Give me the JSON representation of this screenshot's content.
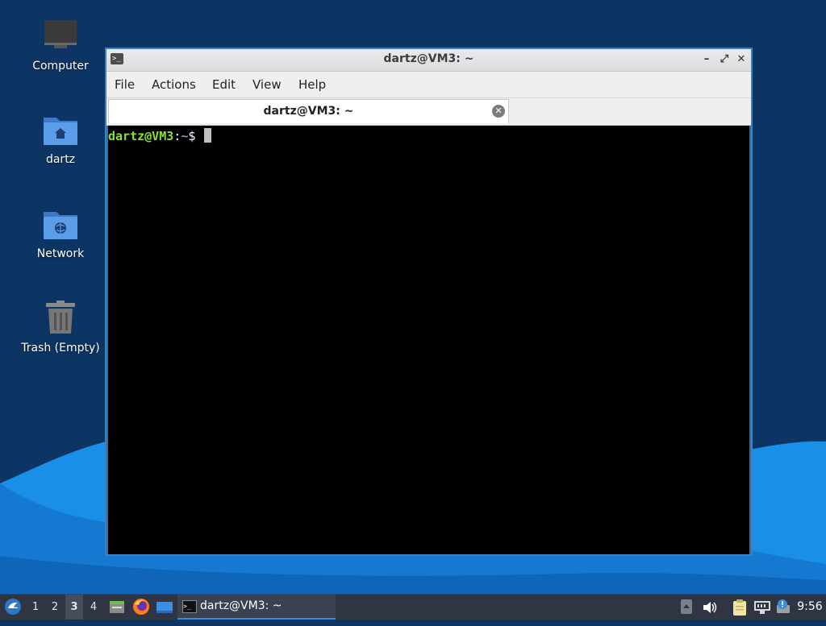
{
  "desktop": {
    "icons": [
      {
        "label": "Computer",
        "icon": "computer-icon"
      },
      {
        "label": "dartz",
        "icon": "home-folder-icon"
      },
      {
        "label": "Network",
        "icon": "network-folder-icon"
      },
      {
        "label": "Trash (Empty)",
        "icon": "trash-icon"
      }
    ]
  },
  "window": {
    "title": "dartz@VM3: ~",
    "controls": {
      "minimize": "–",
      "maximize": "⤢",
      "close": "✕"
    },
    "menu": [
      "File",
      "Actions",
      "Edit",
      "View",
      "Help"
    ],
    "tab": {
      "label": "dartz@VM3: ~",
      "close": "✕"
    },
    "terminal": {
      "prompt_user": "dartz@VM3",
      "prompt_colon": ":",
      "prompt_path": "~",
      "prompt_symbol": "$ "
    }
  },
  "taskbar": {
    "workspaces": [
      "1",
      "2",
      "3",
      "4"
    ],
    "active_workspace": "3",
    "task_label": "dartz@VM3: ~",
    "clock": "9:56",
    "launchers": [
      "file-manager-icon",
      "firefox-icon",
      "show-desktop-icon"
    ],
    "tray": [
      "tray-up-arrow-icon",
      "volume-icon",
      "clipboard-icon",
      "network-wired-icon",
      "update-notifier-icon"
    ]
  },
  "colors": {
    "accent": "#3c8bd8",
    "prompt_user": "#8ae234",
    "prompt_path": "#729fcf",
    "taskbar": "#2f3542"
  }
}
